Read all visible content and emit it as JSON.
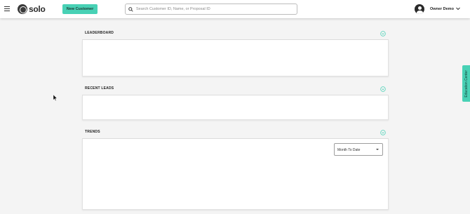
{
  "header": {
    "logo_text": "solo",
    "new_customer_label": "New Customer",
    "search_placeholder": "Search Customer ID, Name, or Proposal ID",
    "user_name": "Owner Demo"
  },
  "panels": [
    {
      "title": "LEADERBOARD"
    },
    {
      "title": "RECENT LEADS"
    },
    {
      "title": "TRENDS",
      "filter_value": "Month To Date"
    }
  ],
  "side_tab": {
    "label": "Education Center"
  },
  "colors": {
    "accent": "#48d1b5",
    "background": "#f4f4f4"
  }
}
